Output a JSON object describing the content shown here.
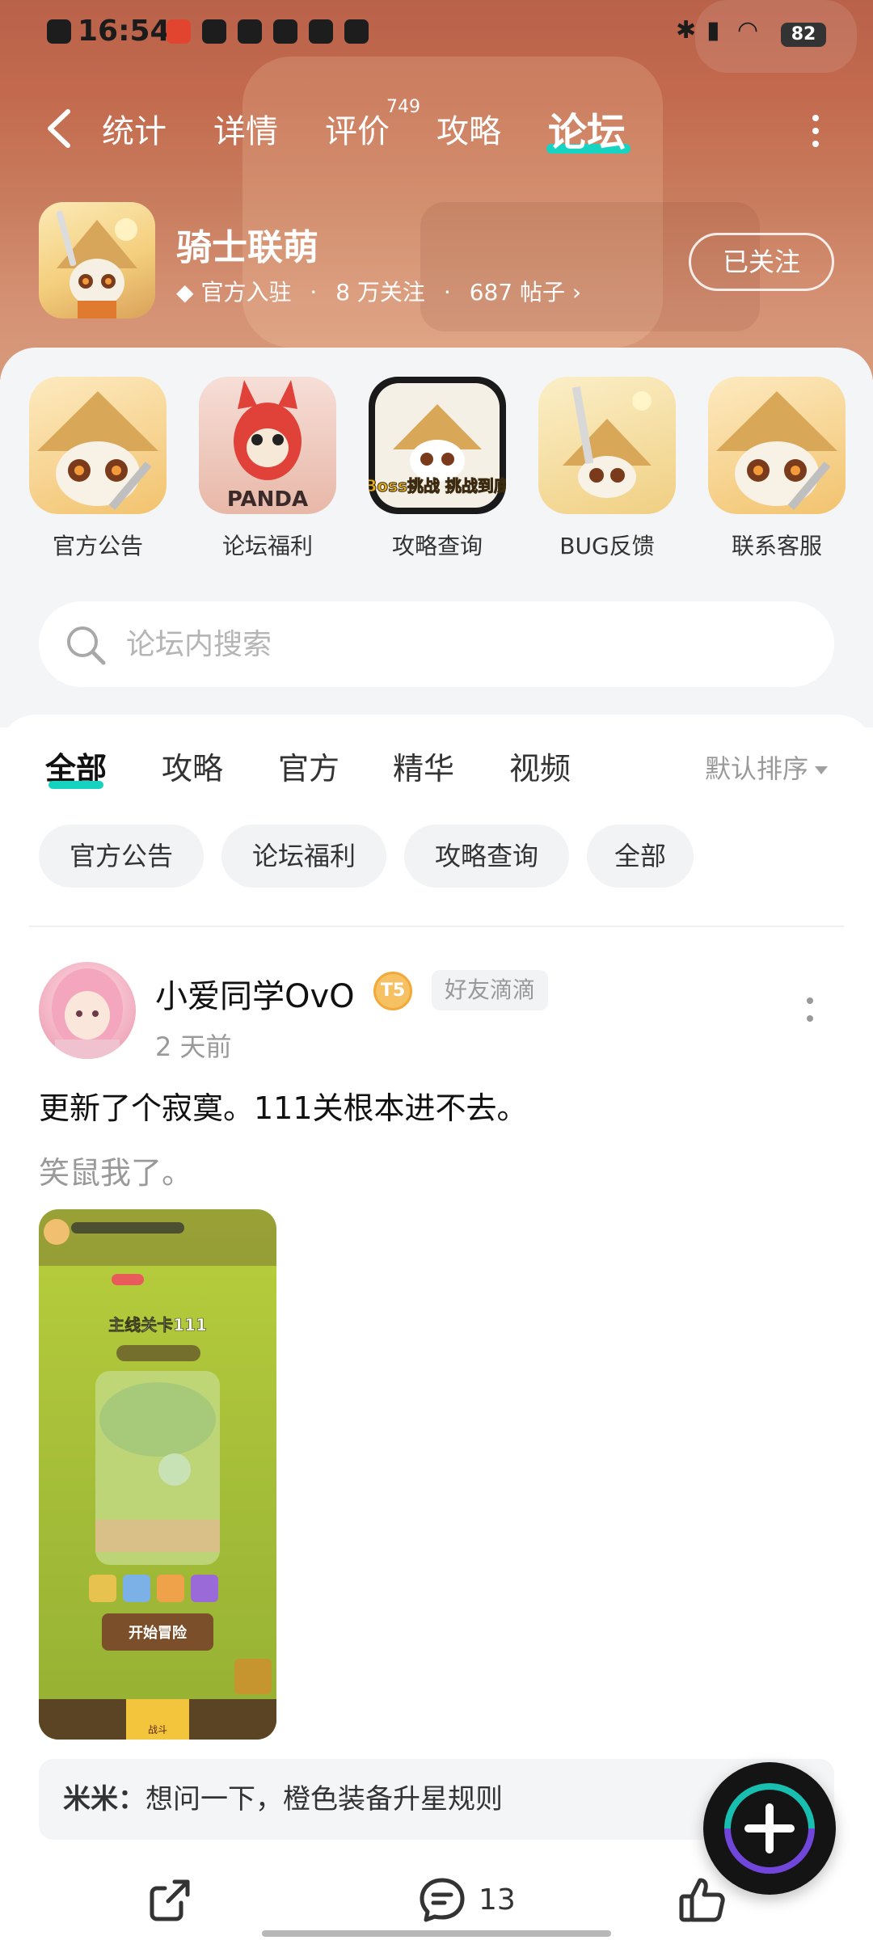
{
  "status_bar": {
    "time": "16:54",
    "battery": "82"
  },
  "nav": {
    "tabs": [
      {
        "label": "统计"
      },
      {
        "label": "详情"
      },
      {
        "label": "评价"
      },
      {
        "label": "攻略"
      },
      {
        "label": "论坛"
      }
    ],
    "review_count": "749",
    "active_tab": "论坛"
  },
  "game": {
    "title": "骑士联萌",
    "official_label": "官方入驻",
    "followers": "8 万关注",
    "posts": "687 帖子",
    "follow_button": "已关注"
  },
  "shortcuts": [
    {
      "label": "官方公告",
      "icon": "official-announcement-icon"
    },
    {
      "label": "论坛福利",
      "icon": "forum-welfare-icon",
      "art_text": "PANDA"
    },
    {
      "label": "攻略查询",
      "icon": "guide-query-icon",
      "art_text": "Boss挑战 挑战到底"
    },
    {
      "label": "BUG反馈",
      "icon": "bug-feedback-icon"
    },
    {
      "label": "联系客服",
      "icon": "customer-service-icon"
    }
  ],
  "search": {
    "placeholder": "论坛内搜索"
  },
  "content_tabs": {
    "tabs": [
      {
        "label": "全部"
      },
      {
        "label": "攻略"
      },
      {
        "label": "官方"
      },
      {
        "label": "精华"
      },
      {
        "label": "视频"
      }
    ],
    "active": "全部",
    "sort_label": "默认排序"
  },
  "chips": [
    {
      "label": "官方公告"
    },
    {
      "label": "论坛福利"
    },
    {
      "label": "攻略查询"
    },
    {
      "label": "全部"
    }
  ],
  "post": {
    "username": "小爱同学OvO",
    "level_badge": "T5",
    "tag": "好友滴滴",
    "time": "2 天前",
    "title": "更新了个寂寞。111关根本进不去。",
    "subtitle": "笑鼠我了。",
    "image": {
      "stage_text": "主线关卡111",
      "start_text": "开始冒险",
      "bottom_tab": "战斗"
    },
    "comment": {
      "author": "米米：",
      "text": "想问一下，橙色装备升星规则"
    },
    "comment_count": "13"
  },
  "colors": {
    "accent": "#16d2c1",
    "header_top": "#b9624a",
    "header_bottom": "#d89a7c",
    "fab": "#141414"
  }
}
